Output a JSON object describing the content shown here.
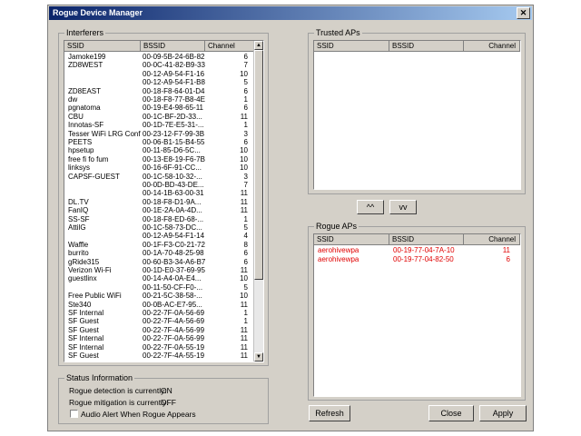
{
  "window": {
    "title": "Rogue Device Manager"
  },
  "interferers": {
    "legend": "Interferers",
    "columns": [
      "SSID",
      "BSSID",
      "Channel"
    ],
    "rows": [
      [
        "Jamoke199",
        "00-09-5B-24-6B-82",
        "6"
      ],
      [
        "ZD8WEST",
        "00-0C-41-82-B9-33",
        "7"
      ],
      [
        "",
        "00-12-A9-54-F1-16",
        "10"
      ],
      [
        "",
        "00-12-A9-54-F1-B8",
        "5"
      ],
      [
        "ZD8EAST",
        "00-18-F8-64-01-D4",
        "6"
      ],
      [
        "dw",
        "00-18-F8-77-B8-4E",
        "1"
      ],
      [
        "pgnatoma",
        "00-19-E4-98-65-11",
        "6"
      ],
      [
        "CBU",
        "00-1C-BF-2D-33...",
        "11"
      ],
      [
        "Innotas-SF",
        "00-1D-7E-E5-31-...",
        "1"
      ],
      [
        "Tesser WiFi LRG Conf...",
        "00-23-12-F7-99-3B",
        "3"
      ],
      [
        "PEETS",
        "00-06-B1-15-B4-55",
        "6"
      ],
      [
        "hpsetup",
        "00-11-85-D6-5C...",
        "10"
      ],
      [
        "free fi fo fum",
        "00-13-E8-19-F6-7B",
        "10"
      ],
      [
        "linksys",
        "00-16-6F-91-CC...",
        "10"
      ],
      [
        "CAPSF-GUEST",
        "00-1C-58-10-32-...",
        "3"
      ],
      [
        "",
        "00-0D-BD-43-DE...",
        "7"
      ],
      [
        "",
        "00-14-1B-63-00-31",
        "11"
      ],
      [
        "DL.TV",
        "00-18-F8-D1-9A...",
        "11"
      ],
      [
        "FanIQ",
        "00-1E-2A-0A-4D...",
        "11"
      ],
      [
        "SS-SF",
        "00-18-F8-ED-68-...",
        "1"
      ],
      [
        "AttilG",
        "00-1C-58-73-DC...",
        "5"
      ],
      [
        "",
        "00-12-A9-54-F1-14",
        "4"
      ],
      [
        "Waffle",
        "00-1F-F3-C0-21-72",
        "8"
      ],
      [
        "burrito",
        "00-1A-70-48-25-98",
        "6"
      ],
      [
        "gRide315",
        "00-60-B3-34-A6-B7",
        "6"
      ],
      [
        "Verizon Wi-Fi",
        "00-1D-E0-37-69-95",
        "11"
      ],
      [
        "guestlinx",
        "00-14-A4-0A-E4...",
        "10"
      ],
      [
        "",
        "00-11-50-CF-F0-...",
        "5"
      ],
      [
        "Free Public WiFi",
        "00-21-5C-38-58-...",
        "10"
      ],
      [
        "Ste340",
        "00-0B-AC-E7-95...",
        "11"
      ],
      [
        "SF Internal",
        "00-22-7F-0A-56-69",
        "1"
      ],
      [
        "SF Guest",
        "00-22-7F-4A-56-69",
        "1"
      ],
      [
        "SF Guest",
        "00-22-7F-4A-56-99",
        "11"
      ],
      [
        "SF Internal",
        "00-22-7F-0A-56-99",
        "11"
      ],
      [
        "SF Internal",
        "00-22-7F-0A-55-19",
        "11"
      ],
      [
        "SF Guest",
        "00-22-7F-4A-55-19",
        "11"
      ]
    ]
  },
  "trusted": {
    "legend": "Trusted APs",
    "columns": [
      "SSID",
      "BSSID",
      "Channel"
    ]
  },
  "move_buttons": {
    "up": "^^",
    "down": "vv"
  },
  "rogue": {
    "legend": "Rogue APs",
    "columns": [
      "SSID",
      "BSSID",
      "Channel"
    ],
    "rows": [
      [
        "aerohivewpa",
        "00-19-77-04-7A-10",
        "11"
      ],
      [
        "aerohivewpa",
        "00-19-77-04-82-50",
        "6"
      ]
    ],
    "row_color": "#e00000"
  },
  "status": {
    "legend": "Status Information",
    "detection_label": "Rogue detection is currently:",
    "detection_value": "ON",
    "mitigation_label": "Rogue mitigation is currently:",
    "mitigation_value": "OFF",
    "audio_alert_label": "Audio Alert When Rogue Appears",
    "audio_alert_checked": false
  },
  "buttons": {
    "refresh": "Refresh",
    "close": "Close",
    "apply": "Apply"
  },
  "icons": {
    "close": "close-icon",
    "scroll_up": "scroll-up-arrow-icon",
    "scroll_down": "scroll-down-arrow-icon"
  }
}
